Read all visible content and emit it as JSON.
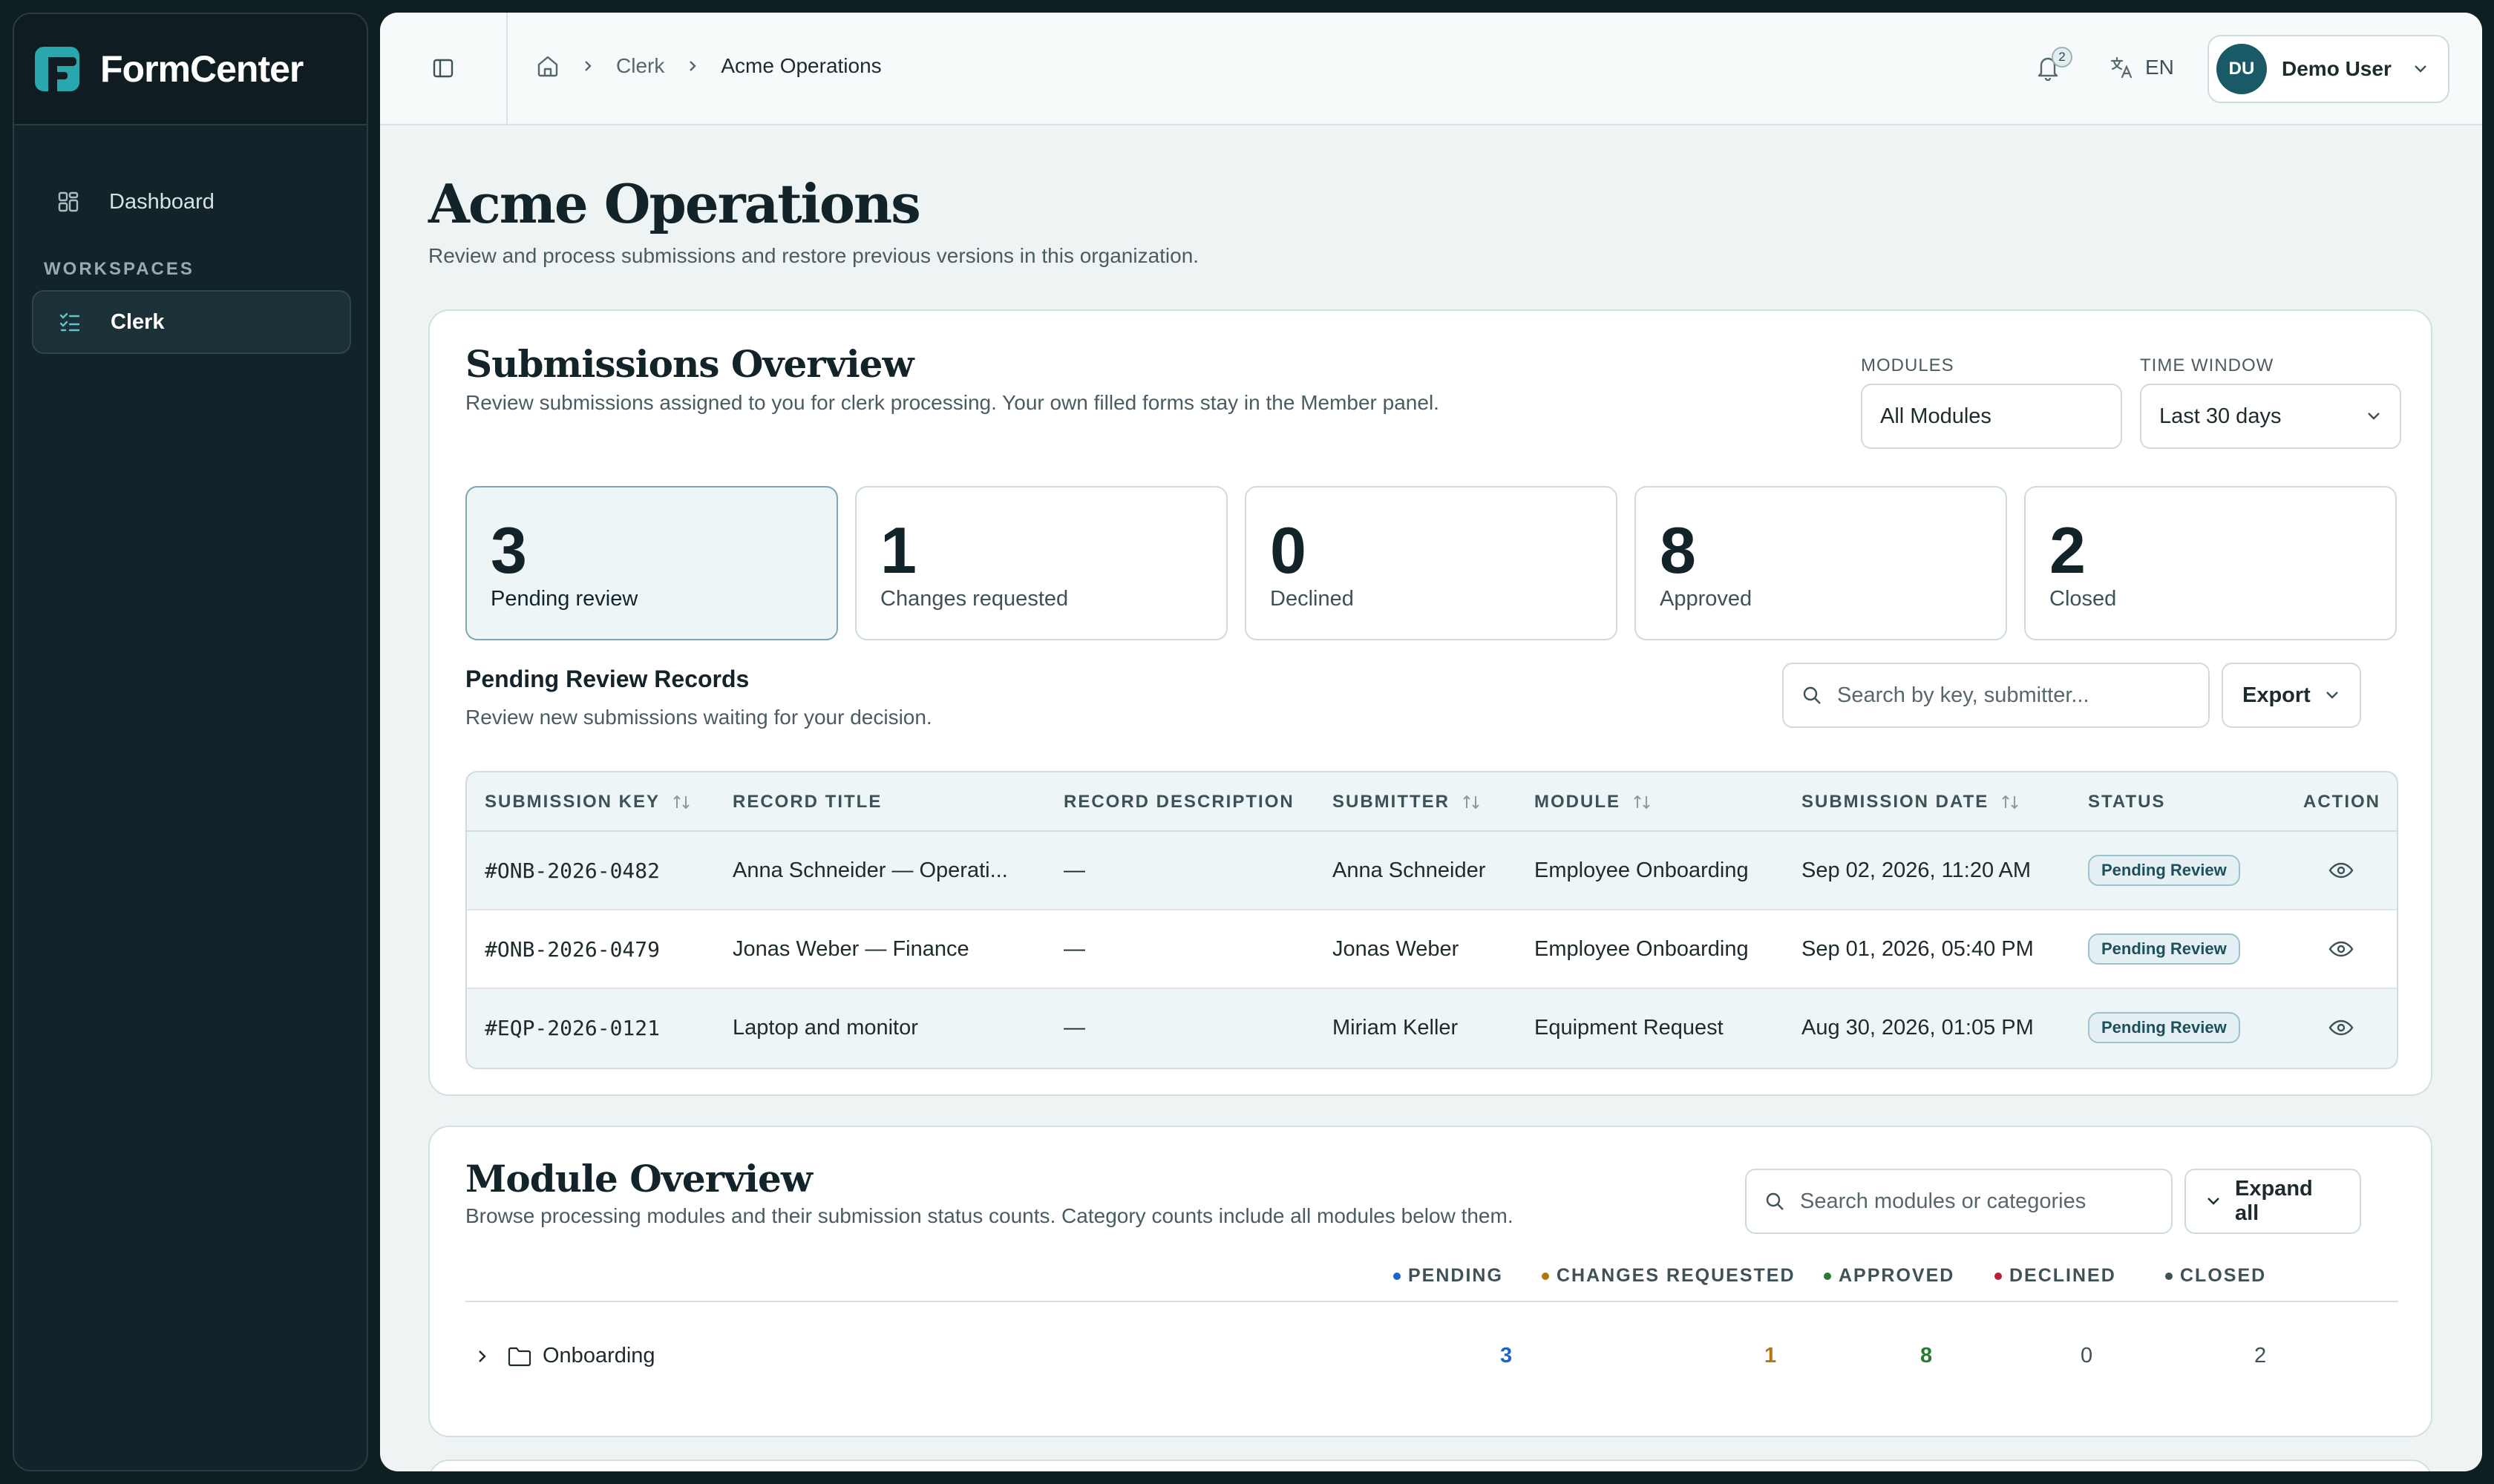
{
  "app": {
    "name": "FormCenter"
  },
  "sidebar": {
    "dashboard_label": "Dashboard",
    "section_label": "WORKSPACES",
    "clerk_label": "Clerk"
  },
  "topbar": {
    "breadcrumb": [
      "Clerk",
      "Acme Operations"
    ],
    "notification_count": "2",
    "language": "EN",
    "user_initials": "DU",
    "user_name": "Demo User"
  },
  "page": {
    "title": "Acme Operations",
    "subtitle": "Review and process submissions and restore previous versions in this organization."
  },
  "submissions": {
    "title": "Submissions Overview",
    "subtitle": "Review submissions assigned to you for clerk processing. Your own filled forms stay in the Member panel.",
    "modules_label": "MODULES",
    "modules_value": "All Modules",
    "time_label": "TIME WINDOW",
    "time_value": "Last 30 days",
    "stats": [
      {
        "value": "3",
        "label": "Pending review"
      },
      {
        "value": "1",
        "label": "Changes requested"
      },
      {
        "value": "0",
        "label": "Declined"
      },
      {
        "value": "8",
        "label": "Approved"
      },
      {
        "value": "2",
        "label": "Closed"
      }
    ],
    "records_title": "Pending Review Records",
    "records_subtitle": "Review new submissions waiting for your decision.",
    "search_placeholder": "Search by key, submitter...",
    "export_label": "Export",
    "columns": [
      "SUBMISSION KEY",
      "RECORD TITLE",
      "RECORD DESCRIPTION",
      "SUBMITTER",
      "MODULE",
      "SUBMISSION DATE",
      "STATUS",
      "ACTION"
    ],
    "rows": [
      {
        "key": "#ONB-2026-0482",
        "title": "Anna Schneider — Operati...",
        "description": "—",
        "submitter": "Anna Schneider",
        "module": "Employee Onboarding",
        "date": "Sep 02, 2026, 11:20 AM",
        "status": "Pending Review"
      },
      {
        "key": "#ONB-2026-0479",
        "title": "Jonas Weber — Finance",
        "description": "—",
        "submitter": "Jonas Weber",
        "module": "Employee Onboarding",
        "date": "Sep 01, 2026, 05:40 PM",
        "status": "Pending Review"
      },
      {
        "key": "#EQP-2026-0121",
        "title": "Laptop and monitor",
        "description": "—",
        "submitter": "Miriam Keller",
        "module": "Equipment Request",
        "date": "Aug 30, 2026, 01:05 PM",
        "status": "Pending Review"
      }
    ]
  },
  "modules": {
    "title": "Module Overview",
    "subtitle": "Browse processing modules and their submission status counts. Category counts include all modules below them.",
    "search_placeholder": "Search modules or categories",
    "expand_label": "Expand all",
    "columns": [
      "PENDING",
      "CHANGES REQUESTED",
      "APPROVED",
      "DECLINED",
      "CLOSED"
    ],
    "colors": {
      "pending": "#1f63c6",
      "changes": "#b3770f",
      "approved": "#2a7a33",
      "declined": "#b8203a",
      "closed": "#3d5157"
    },
    "rows": [
      {
        "name": "Onboarding",
        "pending": "3",
        "changes": "1",
        "approved": "8",
        "declined": "0",
        "closed": "2"
      }
    ]
  }
}
